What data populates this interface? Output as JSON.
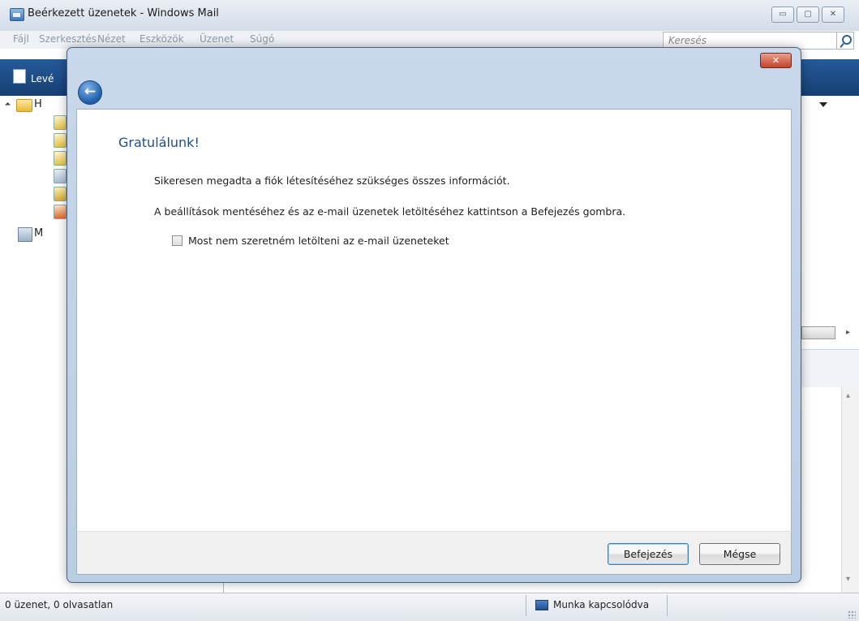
{
  "window": {
    "title": "Beérkezett üzenetek - Windows Mail",
    "min_label": "▭",
    "max_label": "▢",
    "close_label": "✕"
  },
  "menu": {
    "items": [
      "Fájl",
      "Szerkesztés",
      "Nézet",
      "Eszközök",
      "Üzenet",
      "Súgó"
    ]
  },
  "search": {
    "placeholder": "Keresés"
  },
  "toolbar": {
    "new_mail_label": "Levé"
  },
  "folders": {
    "root_label": "H",
    "contacts_label": "M"
  },
  "dialog": {
    "close_label": "✕",
    "back_label": "←",
    "heading": "Gratulálunk!",
    "message1": "Sikeresen megadta a fiók létesítéséhez szükséges összes információt.",
    "message2": "A beállítások mentéséhez és az e-mail üzenetek letöltéséhez kattintson a Befejezés gombra.",
    "checkbox_label": "Most nem szeretném letölteni az e-mail üzeneteket",
    "checkbox_checked": false,
    "finish_label": "Befejezés",
    "cancel_label": "Mégse"
  },
  "status": {
    "left": "0 üzenet, 0 olvasatlan",
    "right": "Munka kapcsolódva"
  },
  "colors": {
    "toolbar": "#1d4a85",
    "heading": "#1f4f86",
    "dialog_frame": "#c2d3e8"
  }
}
